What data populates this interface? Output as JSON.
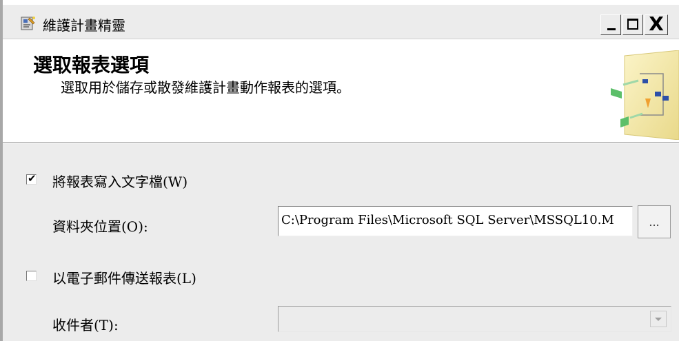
{
  "window": {
    "title": "維護計畫精靈",
    "icon": "wizard-app-icon",
    "controls": {
      "minimize_icon": "minimize-icon",
      "maximize_icon": "maximize-icon",
      "close_glyph": "X"
    }
  },
  "header": {
    "title": "選取報表選項",
    "subtitle": "選取用於儲存或散發維護計畫動作報表的選項。",
    "art_icon": "maintenance-plan-diagram-icon"
  },
  "options": {
    "write_text_file": {
      "label": "將報表寫入文字檔(W)",
      "checked": true,
      "check_glyph": "✔"
    },
    "folder_location": {
      "label": "資料夾位置(O):",
      "value": "C:\\Program Files\\Microsoft SQL Server\\MSSQL10.M",
      "browse_label": "..."
    },
    "email_report": {
      "label": "以電子郵件傳送報表(L)",
      "checked": false
    },
    "recipient": {
      "label": "收件者(T):",
      "value": "",
      "disabled": true
    }
  },
  "colors": {
    "chrome_gray": "#ececec",
    "header_bg": "#ffffff",
    "art_yellow": "#f3e8a0",
    "art_green": "#5cbf6a",
    "art_blue": "#2d4fa8",
    "art_orange": "#f0a030"
  }
}
